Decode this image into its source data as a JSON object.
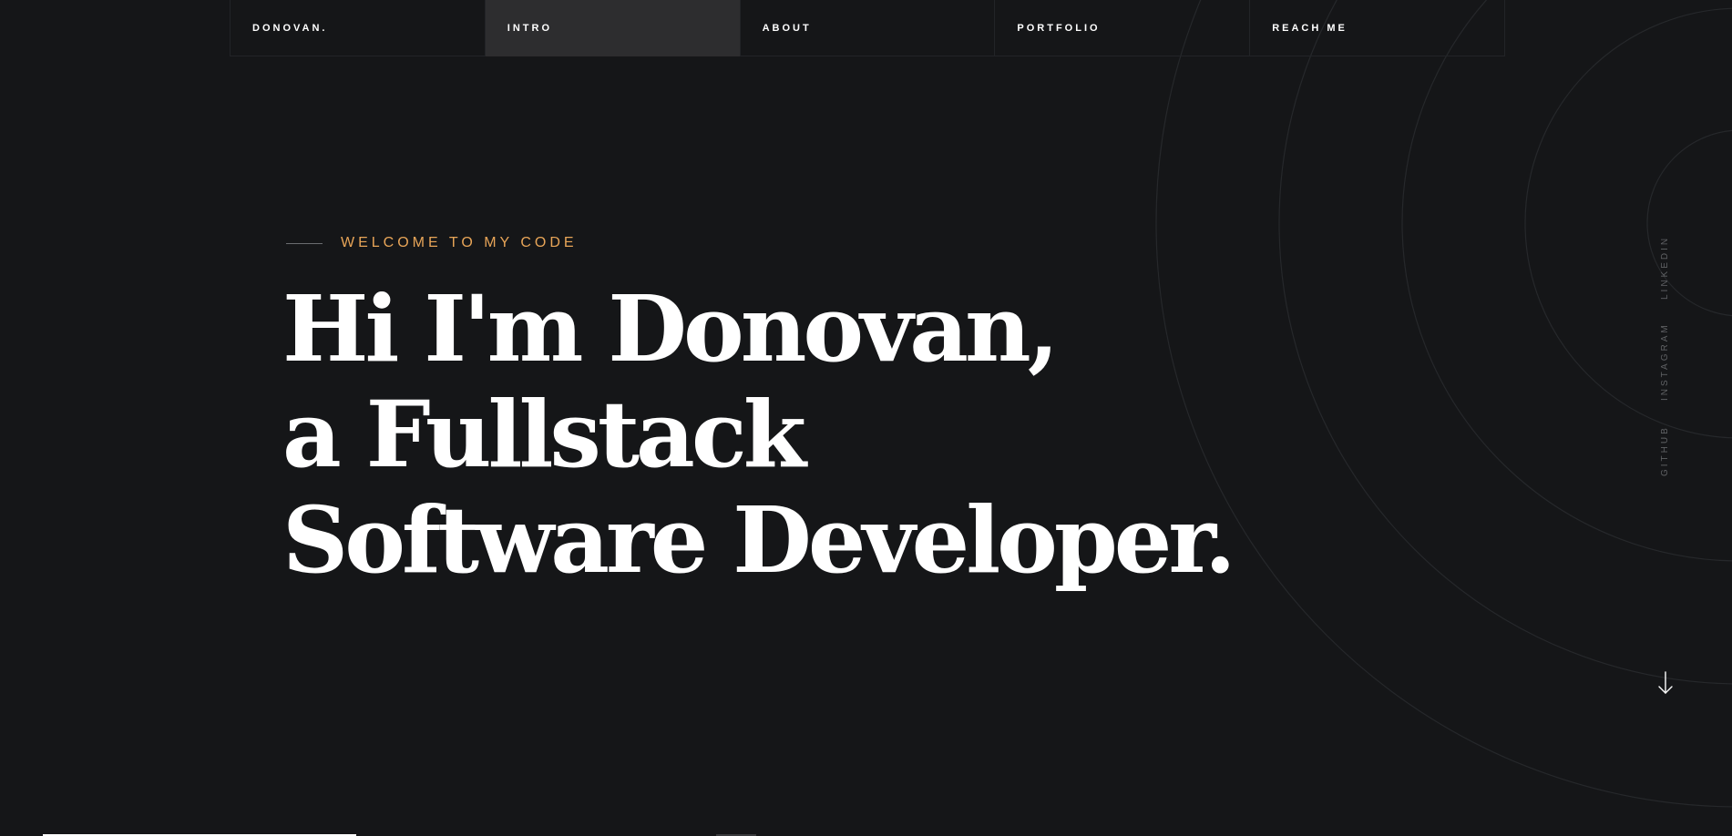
{
  "nav": {
    "brand": "DONOVAN.",
    "items": [
      {
        "label": "INTRO",
        "active": true
      },
      {
        "label": "ABOUT",
        "active": false
      },
      {
        "label": "PORTFOLIO",
        "active": false
      },
      {
        "label": "REACH ME",
        "active": false
      }
    ]
  },
  "hero": {
    "eyebrow": "WELCOME TO MY CODE",
    "headline_lines": [
      "Hi I'm Donovan,",
      "a Fullstack",
      "Software Developer."
    ]
  },
  "social": {
    "links": [
      "LINKEDIN",
      "INSTAGRAM",
      "GITHUB"
    ]
  },
  "icons": {
    "scroll": "arrow-down-icon"
  },
  "colors": {
    "background": "#151618",
    "accent": "#e8a558",
    "nav_active": "#2d2d2f",
    "text": "#ffffff"
  }
}
